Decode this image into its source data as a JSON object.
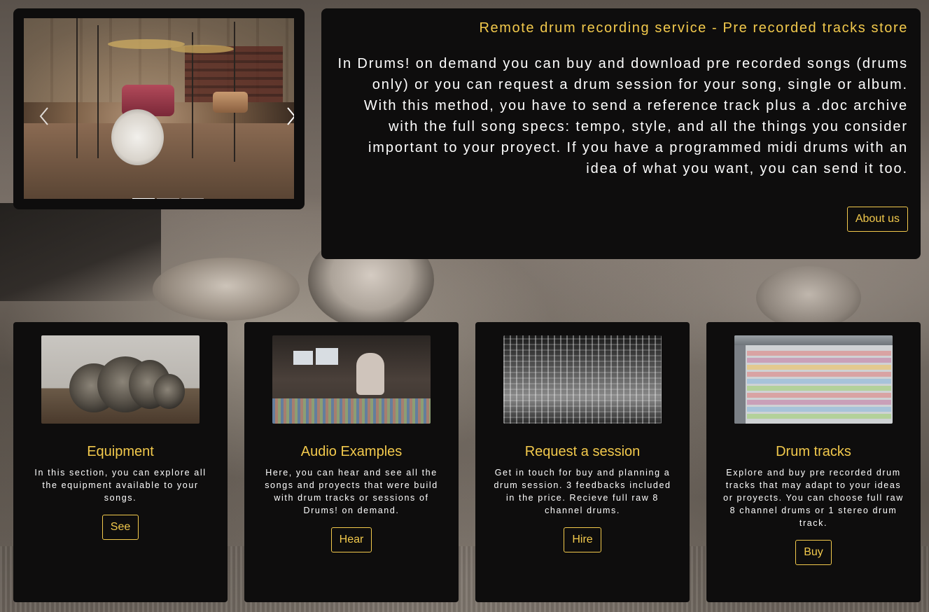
{
  "slider": {
    "prev_arrow": "‹",
    "next_arrow": "›",
    "indicator_count": 3,
    "active_index": 0
  },
  "intro": {
    "title": "Remote drum recording service - Pre recorded tracks store",
    "text": "In Drums! on demand you can buy and download pre recorded songs (drums only) or you can request a drum session for your song, single or album. With this method, you have to send a reference track plus a .doc archive with the full song specs: tempo, style, and all the things you consider important to your proyect. If you have a programmed midi drums with an idea of what you want, you can send it too.",
    "button_label": "About us"
  },
  "cards": [
    {
      "title": "Equipment",
      "text": "In this section, you can explore all the equipment available to your songs.",
      "button_label": "See"
    },
    {
      "title": "Audio Examples",
      "text": "Here, you can hear and see all the songs and proyects that were build with drum tracks or sessions of Drums! on demand.",
      "button_label": "Hear"
    },
    {
      "title": "Request a session",
      "text": "Get in touch for buy and planning a drum session. 3 feedbacks included in the price. Recieve full raw 8 channel drums.",
      "button_label": "Hire"
    },
    {
      "title": "Drum tracks",
      "text": "Explore and buy pre recorded drum tracks that may adapt to your ideas or proyects. You can choose full raw 8 channel drums or 1 stereo drum track.",
      "button_label": "Buy"
    }
  ],
  "colors": {
    "accent": "#f2c94c",
    "panel": "#0e0d0d",
    "text": "#ffffff"
  }
}
